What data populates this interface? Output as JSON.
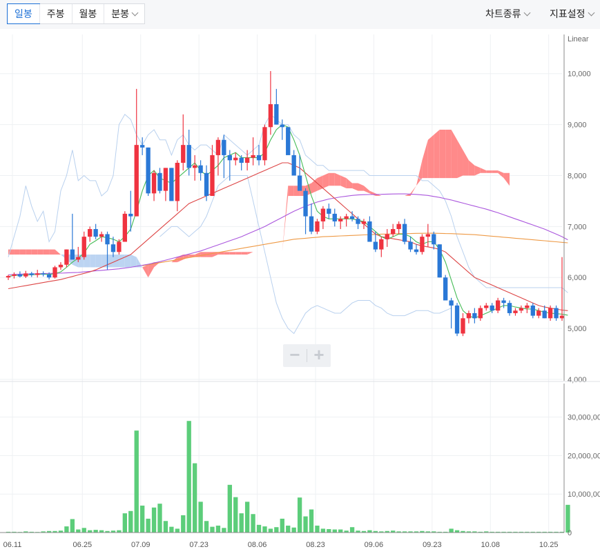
{
  "toolbar": {
    "tabs": [
      "일봉",
      "주봉",
      "월봉",
      "분봉"
    ],
    "active_tab": "일봉",
    "chart_type_label": "차트종류",
    "indicator_label": "지표설정"
  },
  "zoom": {
    "minus": "−",
    "plus": "+"
  },
  "colors": {
    "up": "#ef3340",
    "down": "#2a78d6",
    "volume": "#5ccd7a",
    "ma5": "#44bb55",
    "ma20": "#dd4444",
    "ma60": "#aa55dd",
    "ma120": "#ee9944",
    "cloud_red": "#ff8a8a",
    "cloud_blue": "#bcd4f2",
    "bollinger": "#b8d0ee"
  },
  "chart_data": {
    "type": "candlestick",
    "price_axis": {
      "label": "Linear",
      "ticks": [
        "4,000",
        "5,000",
        "6,000",
        "7,000",
        "8,000",
        "9,000",
        "10,000"
      ],
      "ylim": [
        4000,
        10700
      ]
    },
    "volume_axis": {
      "ticks": [
        "0",
        "10,000,00",
        "20,000,00",
        "30,000,00"
      ],
      "ylim": [
        0,
        38000000
      ]
    },
    "x_ticks": [
      "06.11",
      "06.25",
      "07.09",
      "07.23",
      "08.06",
      "08.23",
      "09.06",
      "09.23",
      "10.08",
      "10.25"
    ],
    "x_tick_index": [
      0,
      12,
      22,
      32,
      42,
      52,
      62,
      72,
      82,
      92
    ],
    "candles": [
      [
        6000,
        6050,
        5950,
        6030
      ],
      [
        6030,
        6100,
        5980,
        6060
      ],
      [
        6060,
        6120,
        6000,
        6020
      ],
      [
        6020,
        6130,
        5990,
        6080
      ],
      [
        6080,
        6110,
        6010,
        6050
      ],
      [
        6050,
        6150,
        6000,
        6080
      ],
      [
        6080,
        6120,
        6020,
        6060
      ],
      [
        6060,
        6100,
        5960,
        6000
      ],
      [
        6000,
        6230,
        5980,
        6200
      ],
      [
        6200,
        6300,
        6150,
        6250
      ],
      [
        6250,
        6550,
        6200,
        6550
      ],
      [
        6550,
        7250,
        6400,
        6350
      ],
      [
        6350,
        6600,
        6300,
        6400
      ],
      [
        6400,
        6900,
        6350,
        6800
      ],
      [
        6800,
        7000,
        6700,
        6950
      ],
      [
        6950,
        7050,
        6750,
        6800
      ],
      [
        6800,
        6900,
        6700,
        6850
      ],
      [
        6850,
        6900,
        6150,
        6650
      ],
      [
        6650,
        6800,
        6400,
        6500
      ],
      [
        6500,
        6750,
        6450,
        6700
      ],
      [
        6700,
        7300,
        6700,
        7250
      ],
      [
        7250,
        7700,
        6900,
        7200
      ],
      [
        7200,
        9700,
        7200,
        8600
      ],
      [
        8600,
        8750,
        8400,
        8550
      ],
      [
        8550,
        8550,
        7600,
        7650
      ],
      [
        7650,
        8100,
        7500,
        8050
      ],
      [
        8050,
        8150,
        7650,
        7700
      ],
      [
        7700,
        8150,
        7500,
        8150
      ],
      [
        8150,
        8150,
        7700,
        7500
      ],
      [
        7500,
        8300,
        7300,
        8250
      ],
      [
        8250,
        9200,
        8100,
        8600
      ],
      [
        8600,
        8900,
        8000,
        8150
      ],
      [
        8150,
        8400,
        7900,
        8200
      ],
      [
        8200,
        8300,
        7900,
        8050
      ],
      [
        8050,
        8200,
        7500,
        7600
      ],
      [
        7600,
        8600,
        7600,
        8400
      ],
      [
        8400,
        8750,
        8000,
        8700
      ],
      [
        8700,
        8800,
        7950,
        8400
      ],
      [
        8400,
        8500,
        7900,
        8300
      ],
      [
        8300,
        8450,
        8200,
        8350
      ],
      [
        8350,
        8400,
        8100,
        8250
      ],
      [
        8250,
        8500,
        8100,
        8350
      ],
      [
        8350,
        8750,
        8200,
        8400
      ],
      [
        8400,
        8600,
        8200,
        8300
      ],
      [
        8300,
        9000,
        8200,
        8950
      ],
      [
        8950,
        10050,
        8800,
        9400
      ],
      [
        9400,
        9700,
        9000,
        9000
      ],
      [
        9000,
        9100,
        8700,
        8950
      ],
      [
        8950,
        8950,
        8450,
        8400
      ],
      [
        8400,
        8500,
        8050,
        8000
      ],
      [
        8000,
        8400,
        7900,
        7700
      ],
      [
        7700,
        7750,
        6850,
        7200
      ],
      [
        7200,
        7450,
        6850,
        6900
      ],
      [
        6900,
        7150,
        6850,
        7100
      ],
      [
        7100,
        7400,
        6950,
        7350
      ],
      [
        7350,
        7450,
        7150,
        7250
      ],
      [
        7250,
        7350,
        7000,
        7100
      ],
      [
        7100,
        7200,
        6950,
        7150
      ],
      [
        7150,
        7250,
        7000,
        7200
      ],
      [
        7200,
        7300,
        7100,
        7150
      ],
      [
        7150,
        7200,
        6950,
        7050
      ],
      [
        7050,
        7150,
        6950,
        7100
      ],
      [
        7100,
        7200,
        6950,
        6700
      ],
      [
        6700,
        6900,
        6500,
        6550
      ],
      [
        6550,
        6800,
        6400,
        6750
      ],
      [
        6750,
        6950,
        6600,
        6850
      ],
      [
        6850,
        7050,
        6800,
        6950
      ],
      [
        6950,
        7100,
        6850,
        7050
      ],
      [
        7050,
        7150,
        6650,
        6700
      ],
      [
        6700,
        6800,
        6500,
        6550
      ],
      [
        6550,
        6650,
        6450,
        6500
      ],
      [
        6500,
        6850,
        6450,
        6800
      ],
      [
        6800,
        7050,
        6600,
        6850
      ],
      [
        6850,
        6900,
        6550,
        6650
      ],
      [
        6650,
        6650,
        6000,
        6000
      ],
      [
        6000,
        6050,
        5600,
        5550
      ],
      [
        5550,
        5600,
        5000,
        5450
      ],
      [
        5450,
        5500,
        4850,
        4900
      ],
      [
        4900,
        5300,
        4850,
        5200
      ],
      [
        5200,
        5350,
        5100,
        5300
      ],
      [
        5300,
        5400,
        5100,
        5200
      ],
      [
        5200,
        5450,
        5150,
        5400
      ],
      [
        5400,
        5500,
        5350,
        5450
      ],
      [
        5450,
        5500,
        5300,
        5350
      ],
      [
        5350,
        5600,
        5300,
        5550
      ],
      [
        5550,
        5600,
        5400,
        5500
      ],
      [
        5500,
        5550,
        5250,
        5300
      ],
      [
        5300,
        5400,
        5250,
        5350
      ],
      [
        5350,
        5450,
        5300,
        5400
      ],
      [
        5400,
        5500,
        5300,
        5450
      ],
      [
        5450,
        5500,
        5200,
        5250
      ],
      [
        5250,
        5400,
        5200,
        5350
      ],
      [
        5350,
        5450,
        5200,
        5200
      ],
      [
        5200,
        5450,
        5150,
        5400
      ],
      [
        5400,
        5450,
        5150,
        5200
      ],
      [
        5200,
        6400,
        5150,
        5250
      ]
    ],
    "volume": [
      200000,
      200000,
      150000,
      300000,
      200000,
      150000,
      300000,
      400000,
      400000,
      500000,
      1600000,
      3500000,
      800000,
      1200000,
      600000,
      700000,
      600000,
      400000,
      500000,
      600000,
      5000000,
      5600000,
      26500000,
      7000000,
      3600000,
      6500000,
      7500000,
      3000000,
      1500000,
      1000000,
      4500000,
      29000000,
      18000000,
      8000000,
      3000000,
      1500000,
      1800000,
      1200000,
      12400000,
      9200000,
      5000000,
      8000000,
      4800000,
      2000000,
      1600000,
      1000000,
      1400000,
      3600000,
      1800000,
      1300000,
      9100000,
      4200000,
      6000000,
      1800000,
      1000000,
      900000,
      800000,
      800000,
      500000,
      1400000,
      500000,
      400000,
      600000,
      400000,
      300000,
      400000,
      500000,
      300000,
      300000,
      300000,
      300000,
      400000,
      300000,
      300000,
      200000,
      200000,
      1000000,
      600000,
      400000,
      300000,
      300000,
      200000,
      300000,
      200000,
      200000,
      200000,
      200000,
      200000,
      200000,
      200000,
      200000,
      200000,
      200000,
      200000,
      200000,
      200000,
      7200000
    ],
    "ma5": [
      6020,
      6040,
      6045,
      6050,
      6050,
      6060,
      6065,
      6060,
      6075,
      6110,
      6200,
      6300,
      6380,
      6480,
      6650,
      6720,
      6800,
      6780,
      6750,
      6700,
      6800,
      6950,
      7300,
      7700,
      8000,
      8100,
      7950,
      7900,
      7850,
      7950,
      8050,
      8150,
      8250,
      8100,
      8000,
      8100,
      8200,
      8350,
      8400,
      8450,
      8350,
      8350,
      8350,
      8350,
      8450,
      8700,
      8900,
      9000,
      8950,
      8700,
      8400,
      8000,
      7600,
      7300,
      7200,
      7150,
      7150,
      7150,
      7150,
      7150,
      7120,
      7100,
      7000,
      6900,
      6800,
      6750,
      6800,
      6850,
      6850,
      6800,
      6700,
      6650,
      6700,
      6700,
      6550,
      6300,
      5950,
      5600,
      5350,
      5250,
      5200,
      5250,
      5300,
      5350,
      5400,
      5450,
      5450,
      5420,
      5400,
      5380,
      5380,
      5350,
      5320,
      5300,
      5290,
      5280,
      5260
    ],
    "ma20": [
      5780,
      5800,
      5820,
      5840,
      5860,
      5880,
      5900,
      5920,
      5940,
      5960,
      5990,
      6020,
      6050,
      6080,
      6110,
      6150,
      6200,
      6250,
      6300,
      6350,
      6400,
      6450,
      6550,
      6650,
      6750,
      6850,
      6950,
      7050,
      7150,
      7250,
      7350,
      7450,
      7500,
      7550,
      7600,
      7650,
      7700,
      7750,
      7800,
      7850,
      7900,
      7950,
      8000,
      8050,
      8100,
      8150,
      8200,
      8250,
      8250,
      8200,
      8150,
      8050,
      7950,
      7850,
      7750,
      7650,
      7550,
      7450,
      7350,
      7250,
      7150,
      7050,
      6950,
      6850,
      6800,
      6780,
      6760,
      6740,
      6720,
      6700,
      6650,
      6620,
      6600,
      6580,
      6550,
      6500,
      6400,
      6300,
      6200,
      6100,
      6000,
      5950,
      5900,
      5850,
      5800,
      5750,
      5700,
      5650,
      5600,
      5550,
      5500,
      5450,
      5420,
      5400,
      5380,
      5360,
      5350
    ],
    "ma60": [
      6050,
      6060,
      6065,
      6070,
      6072,
      6075,
      6078,
      6080,
      6082,
      6085,
      6090,
      6095,
      6100,
      6110,
      6120,
      6130,
      6140,
      6150,
      6160,
      6170,
      6185,
      6200,
      6220,
      6240,
      6260,
      6285,
      6310,
      6340,
      6370,
      6400,
      6430,
      6460,
      6490,
      6520,
      6560,
      6600,
      6640,
      6680,
      6720,
      6760,
      6800,
      6850,
      6900,
      6950,
      7000,
      7060,
      7120,
      7180,
      7240,
      7300,
      7350,
      7400,
      7440,
      7480,
      7510,
      7540,
      7560,
      7580,
      7595,
      7610,
      7620,
      7625,
      7628,
      7630,
      7632,
      7635,
      7638,
      7640,
      7640,
      7635,
      7630,
      7620,
      7610,
      7590,
      7570,
      7545,
      7520,
      7490,
      7460,
      7430,
      7400,
      7370,
      7340,
      7305,
      7270,
      7230,
      7190,
      7150,
      7110,
      7070,
      7030,
      6990,
      6950,
      6900,
      6850,
      6800,
      6740
    ],
    "ma120": [
      null,
      null,
      null,
      null,
      null,
      null,
      null,
      null,
      null,
      null,
      null,
      null,
      null,
      null,
      null,
      null,
      null,
      null,
      null,
      null,
      null,
      null,
      null,
      6230,
      6250,
      6270,
      6290,
      6310,
      6330,
      6350,
      6370,
      6390,
      6410,
      6430,
      6450,
      6470,
      6490,
      6510,
      6530,
      6550,
      6570,
      6590,
      6610,
      6630,
      6650,
      6670,
      6690,
      6710,
      6730,
      6750,
      6760,
      6770,
      6780,
      6790,
      6800,
      6805,
      6810,
      6815,
      6820,
      6825,
      6830,
      6835,
      6840,
      6845,
      6850,
      6852,
      6855,
      6858,
      6860,
      6862,
      6865,
      6867,
      6870,
      6868,
      6865,
      6862,
      6860,
      6855,
      6850,
      6845,
      6840,
      6830,
      6820,
      6810,
      6800,
      6790,
      6780,
      6770,
      6760,
      6750,
      6740,
      6730,
      6720,
      6710,
      6700,
      6690,
      6680
    ],
    "boll_upper": [
      6400,
      6800,
      7200,
      7800,
      7400,
      7100,
      7300,
      6700,
      6900,
      7700,
      8000,
      8500,
      7900,
      8000,
      7900,
      7900,
      7600,
      7700,
      8000,
      9000,
      9200,
      9100,
      8800,
      8600,
      8800,
      8900,
      8700,
      8700,
      8400,
      8700,
      8800,
      8600,
      8500,
      8600,
      8600,
      8500,
      8400,
      8800,
      8700,
      8600,
      8500,
      8400,
      8500,
      8600,
      9000,
      9200,
      9100,
      9000,
      9000,
      8800,
      8700,
      8400,
      8300,
      8200,
      8200,
      8100,
      8100,
      8100,
      8100,
      8100,
      8100,
      8100,
      8000,
      8000,
      8000,
      8000,
      8000,
      8000,
      8000,
      8000,
      8000,
      7900,
      7900,
      7800,
      7700,
      7500,
      7200,
      6800,
      6500,
      6200,
      6000,
      5900,
      5800,
      5800,
      5800,
      5800,
      5800,
      5800,
      5800,
      5800,
      5800,
      5800,
      5800,
      5800,
      5800,
      5800,
      5700
    ],
    "boll_lower": [
      null,
      null,
      null,
      null,
      null,
      null,
      null,
      null,
      null,
      null,
      null,
      null,
      null,
      null,
      null,
      null,
      null,
      null,
      null,
      null,
      null,
      null,
      null,
      null,
      null,
      null,
      6800,
      6900,
      7000,
      7000,
      6900,
      6800,
      6900,
      7000,
      7200,
      7500,
      7800,
      7900,
      8000,
      8000,
      8000,
      8000,
      7500,
      7000,
      6500,
      6000,
      5500,
      5200,
      5000,
      4900,
      5100,
      5300,
      5400,
      5450,
      5400,
      5350,
      5300,
      5300,
      5400,
      5500,
      5550,
      5550,
      5550,
      5450,
      5400,
      5300,
      5250,
      5250,
      5250,
      5300,
      5350,
      5350,
      5350,
      5300,
      5300,
      5350,
      5400,
      null,
      null,
      null,
      null,
      null,
      null,
      null,
      null,
      null,
      null,
      null,
      null,
      null,
      null,
      null,
      null,
      null,
      null,
      null,
      null
    ],
    "span_a": [
      6550,
      6550,
      6550,
      6550,
      6550,
      6550,
      6550,
      6550,
      6550,
      6450,
      6350,
      6250,
      6200,
      6200,
      6200,
      6200,
      6200,
      6200,
      6200,
      6200,
      6200,
      6200,
      6200,
      6200,
      6250,
      6300,
      6300,
      6300,
      6300,
      6400,
      6450,
      6450,
      6450,
      6500,
      6500,
      6500,
      6500,
      6500,
      6500,
      6500,
      6500,
      6500,
      6500,
      6500,
      6500,
      6500,
      6500,
      6500,
      7800,
      7800,
      7800,
      7800,
      7850,
      7950,
      8000,
      8050,
      8050,
      8000,
      7950,
      7850,
      7850,
      7800,
      7700,
      7650,
      7600,
      7600,
      7600,
      7600,
      7600,
      7650,
      7800,
      8300,
      8700,
      8800,
      8900,
      8900,
      8900,
      8700,
      8500,
      8300,
      8200,
      8150,
      8100,
      8100,
      8100,
      8050,
      8050,
      null,
      null,
      null,
      null,
      null,
      null,
      null,
      null,
      null,
      null
    ],
    "span_b": [
      6450,
      6450,
      6450,
      6450,
      6450,
      6450,
      6450,
      6450,
      6450,
      6450,
      6450,
      6450,
      6450,
      6450,
      6450,
      6450,
      6450,
      6450,
      6450,
      6450,
      6450,
      6450,
      6400,
      6200,
      6000,
      6200,
      6300,
      6300,
      6300,
      6300,
      6350,
      6400,
      6400,
      6400,
      6400,
      6400,
      6450,
      6450,
      6450,
      6450,
      6450,
      6450,
      6500,
      6500,
      6500,
      6500,
      6500,
      6500,
      7600,
      7600,
      7600,
      7600,
      7650,
      7700,
      7750,
      7800,
      7800,
      7800,
      7750,
      7750,
      7700,
      7700,
      7650,
      7600,
      7600,
      7600,
      7600,
      7600,
      7600,
      7600,
      7800,
      7950,
      7950,
      7950,
      7950,
      7950,
      7950,
      7950,
      8000,
      8000,
      8000,
      8050,
      8050,
      8050,
      8050,
      7950,
      7800,
      7700,
      7600,
      7500,
      7450,
      7400,
      7300,
      7200,
      7100,
      7100,
      7100
    ]
  }
}
